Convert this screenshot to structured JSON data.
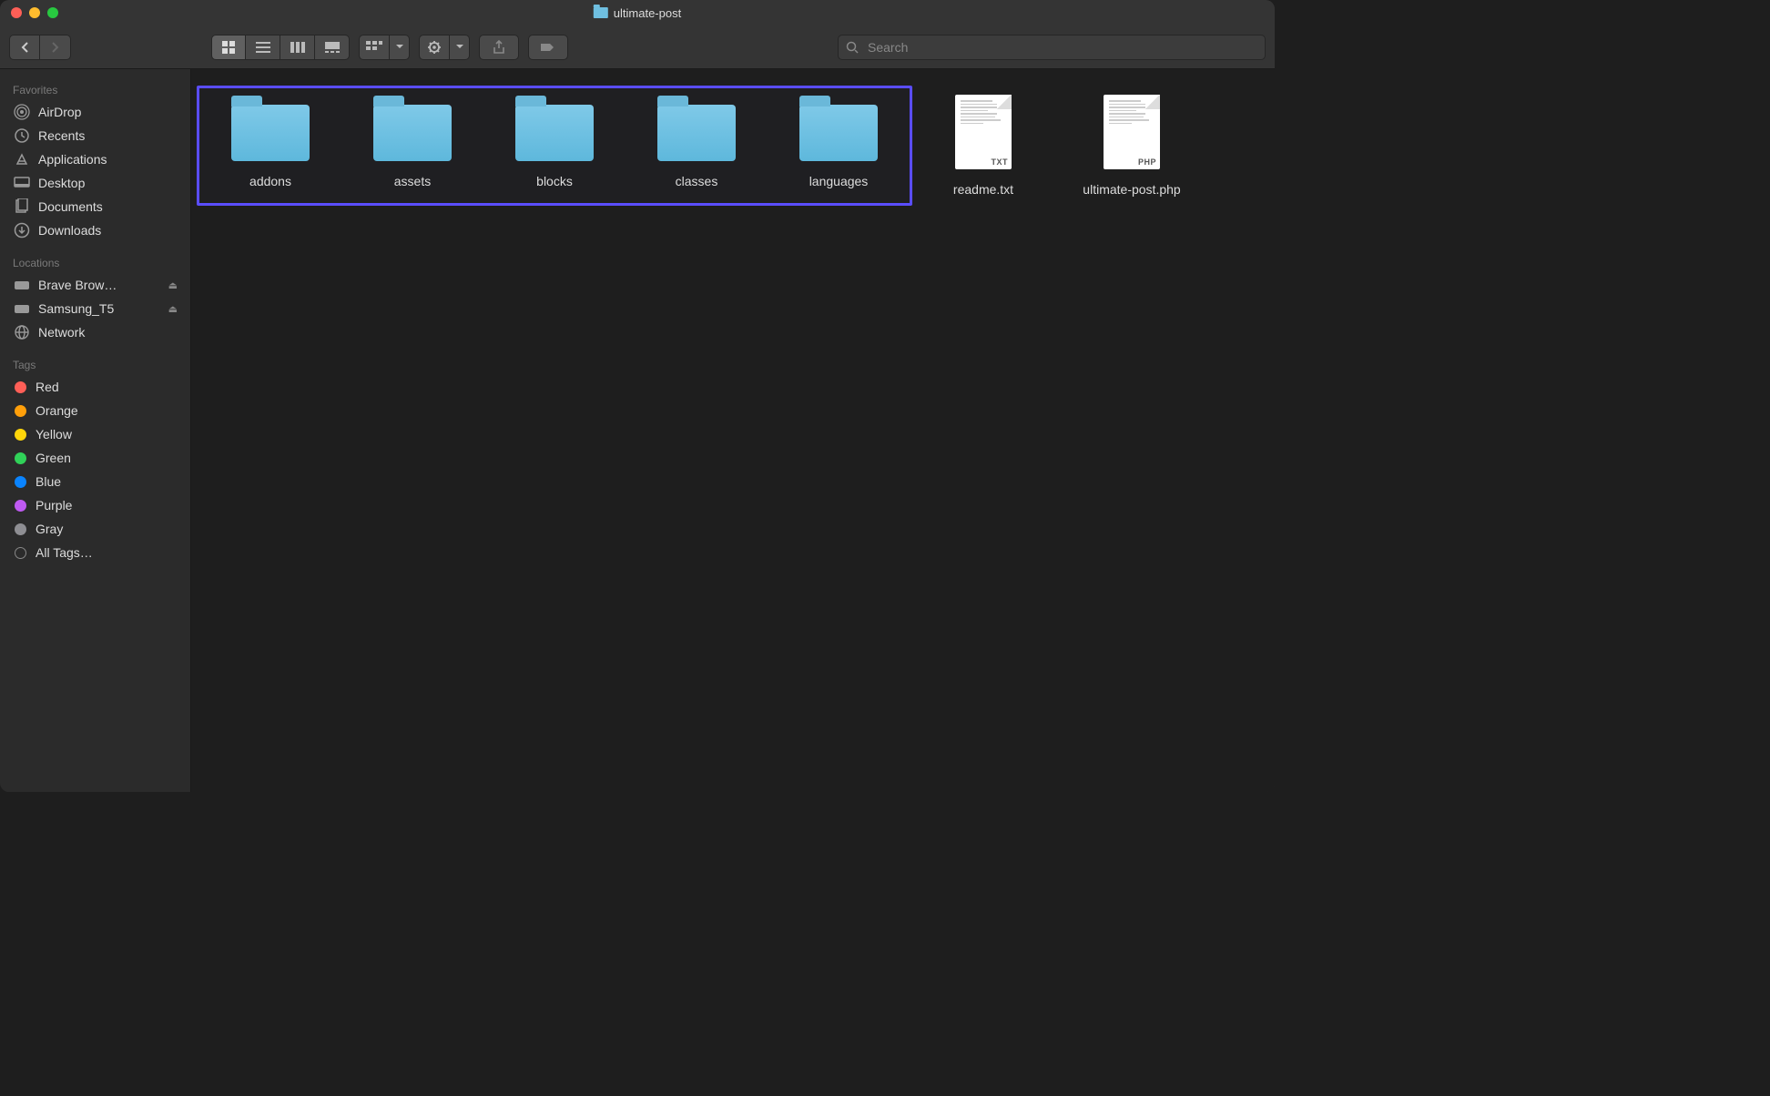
{
  "window": {
    "title": "ultimate-post"
  },
  "search": {
    "placeholder": "Search"
  },
  "sidebar": {
    "sections": {
      "favorites": {
        "title": "Favorites",
        "items": [
          {
            "label": "AirDrop"
          },
          {
            "label": "Recents"
          },
          {
            "label": "Applications"
          },
          {
            "label": "Desktop"
          },
          {
            "label": "Documents"
          },
          {
            "label": "Downloads"
          }
        ]
      },
      "locations": {
        "title": "Locations",
        "items": [
          {
            "label": "Brave Brow…",
            "ejectable": true
          },
          {
            "label": "Samsung_T5",
            "ejectable": true
          },
          {
            "label": "Network"
          }
        ]
      },
      "tags": {
        "title": "Tags",
        "items": [
          {
            "label": "Red",
            "color": "red"
          },
          {
            "label": "Orange",
            "color": "orange"
          },
          {
            "label": "Yellow",
            "color": "yellow"
          },
          {
            "label": "Green",
            "color": "green"
          },
          {
            "label": "Blue",
            "color": "blue"
          },
          {
            "label": "Purple",
            "color": "purple"
          },
          {
            "label": "Gray",
            "color": "gray"
          },
          {
            "label": "All Tags…",
            "color": "all"
          }
        ]
      }
    }
  },
  "content": {
    "selected_folders": [
      {
        "name": "addons"
      },
      {
        "name": "assets"
      },
      {
        "name": "blocks"
      },
      {
        "name": "classes"
      },
      {
        "name": "languages"
      }
    ],
    "files": [
      {
        "name": "readme.txt",
        "badge": "TXT"
      },
      {
        "name": "ultimate-post.php",
        "badge": "PHP"
      }
    ]
  }
}
